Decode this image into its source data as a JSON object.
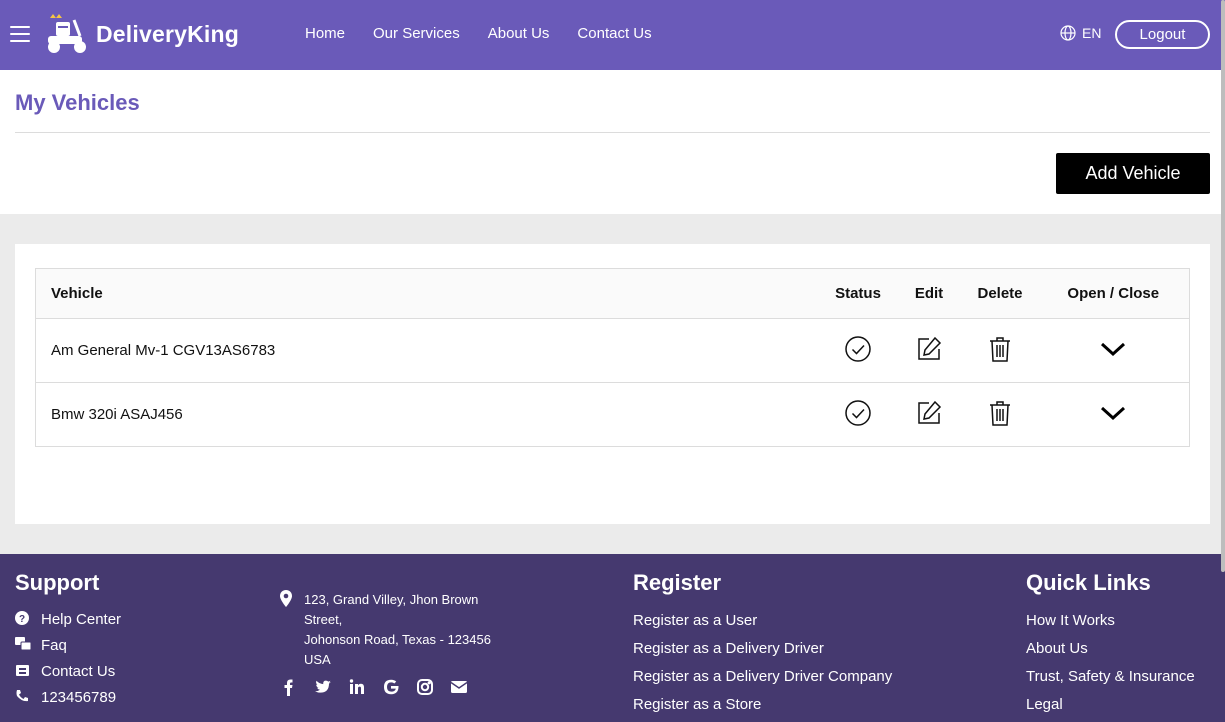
{
  "brand": {
    "name": "DeliveryKing"
  },
  "nav": {
    "items": [
      "Home",
      "Our Services",
      "About Us",
      "Contact Us"
    ]
  },
  "lang": {
    "label": "EN"
  },
  "auth": {
    "logout_label": "Logout"
  },
  "page": {
    "title": "My Vehicles",
    "add_button": "Add Vehicle"
  },
  "table": {
    "headers": {
      "vehicle": "Vehicle",
      "status": "Status",
      "edit": "Edit",
      "delete": "Delete",
      "toggle": "Open / Close"
    },
    "rows": [
      {
        "vehicle": "Am General Mv-1 CGV13AS6783"
      },
      {
        "vehicle": "Bmw 320i ASAJ456"
      }
    ]
  },
  "footer": {
    "support": {
      "title": "Support",
      "items": [
        "Help Center",
        "Faq",
        "Contact Us",
        "123456789"
      ]
    },
    "address": {
      "lines": [
        "123, Grand Villey, Jhon Brown",
        "Street,",
        "Johonson Road, Texas - 123456",
        "USA"
      ]
    },
    "register": {
      "title": "Register",
      "items": [
        "Register as a User",
        "Register as a Delivery Driver",
        "Register as a Delivery Driver Company",
        "Register as a Store"
      ]
    },
    "quick_links": {
      "title": "Quick Links",
      "items": [
        "How It Works",
        "About Us",
        "Trust, Safety & Insurance",
        "Legal"
      ]
    }
  },
  "colors": {
    "primary": "#6a5ab9",
    "footer": "#45396f",
    "button": "#000000"
  }
}
